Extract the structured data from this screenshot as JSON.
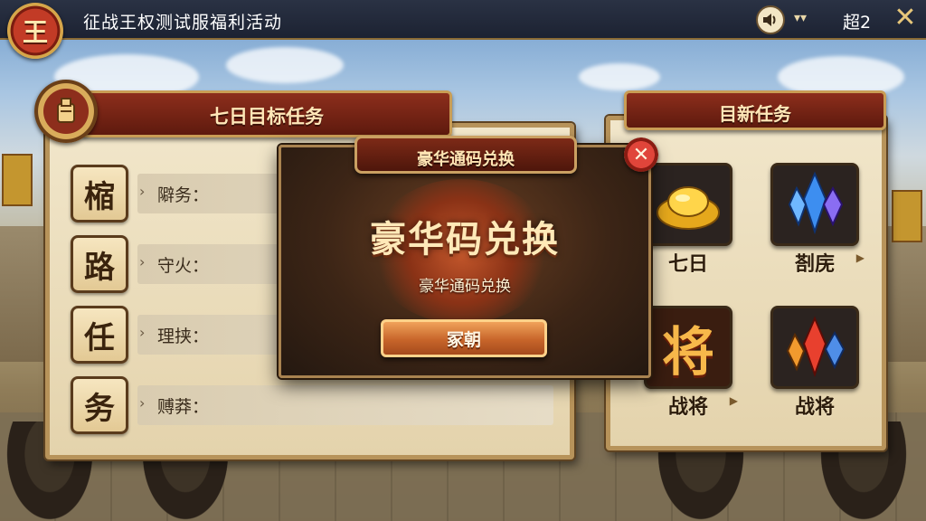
{
  "header": {
    "emblem_char": "王",
    "title": "征战王权测试服福利活动",
    "server_label": "超2",
    "speaker_icon": "speaker-icon",
    "caret_icon": "chevron-down-icon",
    "close_icon": "close-icon"
  },
  "left_panel": {
    "title": "七日目标任务",
    "emblem_icon": "helmet-icon",
    "rows": [
      {
        "glyph": "樎",
        "label": "隦务："
      },
      {
        "glyph": "路",
        "label": "守火："
      },
      {
        "glyph": "任",
        "label": "理挟："
      },
      {
        "glyph": "务",
        "label": "赙莽："
      }
    ]
  },
  "right_panel": {
    "title": "目新任务",
    "tiles": [
      {
        "label": "七日",
        "icon": "gold-ingot-icon"
      },
      {
        "label": "剳庑",
        "icon": "blue-crystal-icon"
      },
      {
        "label": "战将",
        "icon": "general-character-icon",
        "icon_char": "将"
      },
      {
        "label": "战将",
        "icon": "red-crystal-icon"
      }
    ]
  },
  "modal": {
    "header_title": "豪华通码兑换",
    "headline": "豪华码兑换",
    "subtitle": "豪华通码兑换",
    "button_label": "冢朝",
    "close_icon": "close-icon"
  },
  "colors": {
    "banner_red": "#8d2e1c",
    "parchment": "#f1e6ca",
    "gold_trim": "#c99d55",
    "button_orange": "#c7652a"
  }
}
